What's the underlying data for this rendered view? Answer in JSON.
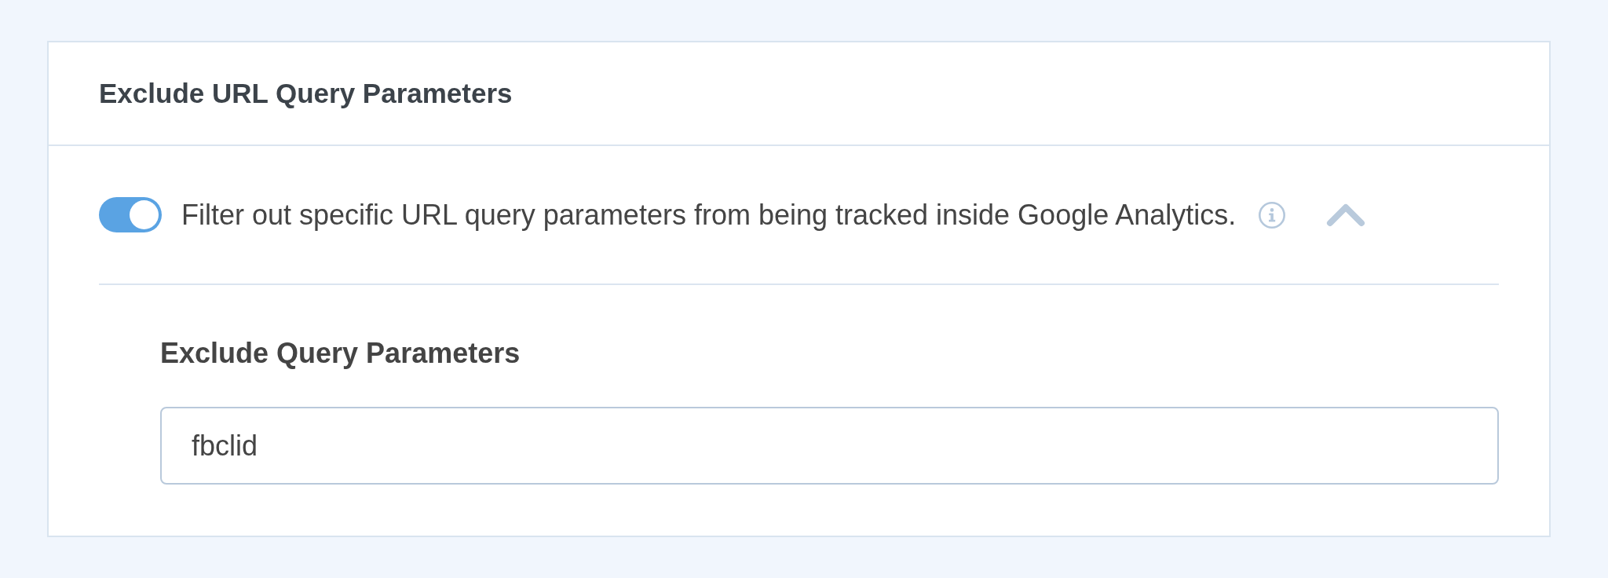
{
  "panel": {
    "title": "Exclude URL Query Parameters"
  },
  "setting": {
    "on": true,
    "description": "Filter out specific URL query parameters from being tracked inside Google Analytics.",
    "expanded": true
  },
  "field": {
    "label": "Exclude Query Parameters",
    "value": "fbclid"
  }
}
